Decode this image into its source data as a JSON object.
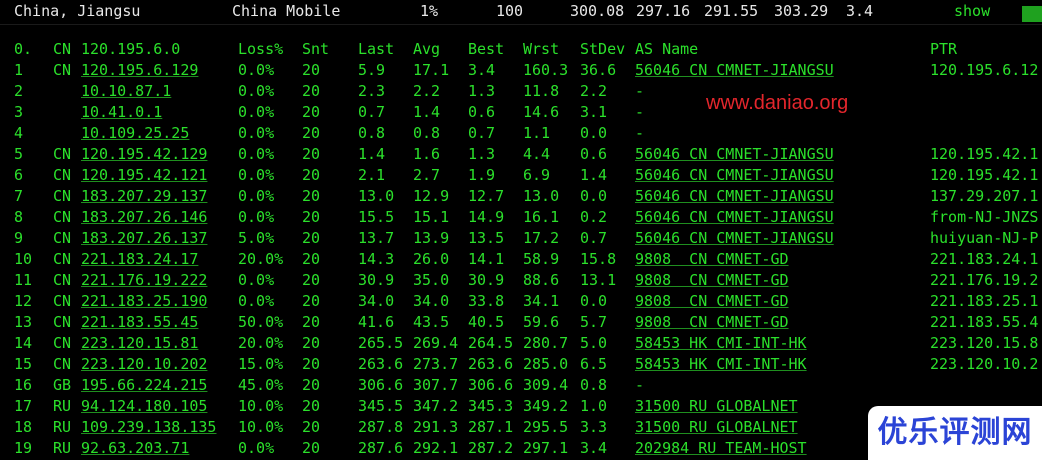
{
  "topbar": {
    "location": "China, Jiangsu",
    "isp": "China Mobile",
    "loss": "1%",
    "sent": "100",
    "last": "300.08",
    "avg": "297.16",
    "best": "291.55",
    "wrst": "303.29",
    "stdev": "3.4",
    "show_label": "show"
  },
  "headers": [
    "0.",
    "CN",
    "120.195.6.0",
    "Loss%",
    "Snt",
    "Last",
    "Avg",
    "Best",
    "Wrst",
    "StDev",
    "AS Name",
    "PTR"
  ],
  "rows": [
    [
      "1",
      "CN",
      "120.195.6.129",
      "0.0%",
      "20",
      "5.9",
      "17.1",
      "3.4",
      "160.3",
      "36.6",
      "56046 CN CMNET-JIANGSU",
      "120.195.6.12"
    ],
    [
      "2",
      "",
      "10.10.87.1",
      "0.0%",
      "20",
      "2.3",
      "2.2",
      "1.3",
      "11.8",
      "2.2",
      "-",
      ""
    ],
    [
      "3",
      "",
      "10.41.0.1",
      "0.0%",
      "20",
      "0.7",
      "1.4",
      "0.6",
      "14.6",
      "3.1",
      "-",
      ""
    ],
    [
      "4",
      "",
      "10.109.25.25",
      "0.0%",
      "20",
      "0.8",
      "0.8",
      "0.7",
      "1.1",
      "0.0",
      "-",
      ""
    ],
    [
      "5",
      "CN",
      "120.195.42.129",
      "0.0%",
      "20",
      "1.4",
      "1.6",
      "1.3",
      "4.4",
      "0.6",
      "56046 CN CMNET-JIANGSU",
      "120.195.42.1"
    ],
    [
      "6",
      "CN",
      "120.195.42.121",
      "0.0%",
      "20",
      "2.1",
      "2.7",
      "1.9",
      "6.9",
      "1.4",
      "56046 CN CMNET-JIANGSU",
      "120.195.42.1"
    ],
    [
      "7",
      "CN",
      "183.207.29.137",
      "0.0%",
      "20",
      "13.0",
      "12.9",
      "12.7",
      "13.0",
      "0.0",
      "56046 CN CMNET-JIANGSU",
      "137.29.207.1"
    ],
    [
      "8",
      "CN",
      "183.207.26.146",
      "0.0%",
      "20",
      "15.5",
      "15.1",
      "14.9",
      "16.1",
      "0.2",
      "56046 CN CMNET-JIANGSU",
      "from-NJ-JNZS"
    ],
    [
      "9",
      "CN",
      "183.207.26.137",
      "5.0%",
      "20",
      "13.7",
      "13.9",
      "13.5",
      "17.2",
      "0.7",
      "56046 CN CMNET-JIANGSU",
      "huiyuan-NJ-P"
    ],
    [
      "10",
      "CN",
      "221.183.24.17",
      "20.0%",
      "20",
      "14.3",
      "26.0",
      "14.1",
      "58.9",
      "15.8",
      "9808  CN CMNET-GD",
      "221.183.24.1"
    ],
    [
      "11",
      "CN",
      "221.176.19.222",
      "0.0%",
      "20",
      "30.9",
      "35.0",
      "30.9",
      "88.6",
      "13.1",
      "9808  CN CMNET-GD",
      "221.176.19.2"
    ],
    [
      "12",
      "CN",
      "221.183.25.190",
      "0.0%",
      "20",
      "34.0",
      "34.0",
      "33.8",
      "34.1",
      "0.0",
      "9808  CN CMNET-GD",
      "221.183.25.1"
    ],
    [
      "13",
      "CN",
      "221.183.55.45",
      "50.0%",
      "20",
      "41.6",
      "43.5",
      "40.5",
      "59.6",
      "5.7",
      "9808  CN CMNET-GD",
      "221.183.55.4"
    ],
    [
      "14",
      "CN",
      "223.120.15.81",
      "20.0%",
      "20",
      "265.5",
      "269.4",
      "264.5",
      "280.7",
      "5.0",
      "58453 HK CMI-INT-HK",
      "223.120.15.8"
    ],
    [
      "15",
      "CN",
      "223.120.10.202",
      "15.0%",
      "20",
      "263.6",
      "273.7",
      "263.6",
      "285.0",
      "6.5",
      "58453 HK CMI-INT-HK",
      "223.120.10.2"
    ],
    [
      "16",
      "GB",
      "195.66.224.215",
      "45.0%",
      "20",
      "306.6",
      "307.7",
      "306.6",
      "309.4",
      "0.8",
      "-",
      ""
    ],
    [
      "17",
      "RU",
      "94.124.180.105",
      "10.0%",
      "20",
      "345.5",
      "347.2",
      "345.3",
      "349.2",
      "1.0",
      "31500 RU GLOBALNET",
      ""
    ],
    [
      "18",
      "RU",
      "109.239.138.135",
      "10.0%",
      "20",
      "287.8",
      "291.3",
      "287.1",
      "295.5",
      "3.3",
      "31500 RU GLOBALNET",
      ""
    ],
    [
      "19",
      "RU",
      "92.63.203.71",
      "0.0%",
      "20",
      "287.6",
      "292.1",
      "287.2",
      "297.1",
      "3.4",
      "202984 RU TEAM-HOST",
      ""
    ]
  ],
  "watermark": "www.daniao.org",
  "logo_text": "优乐评测网"
}
